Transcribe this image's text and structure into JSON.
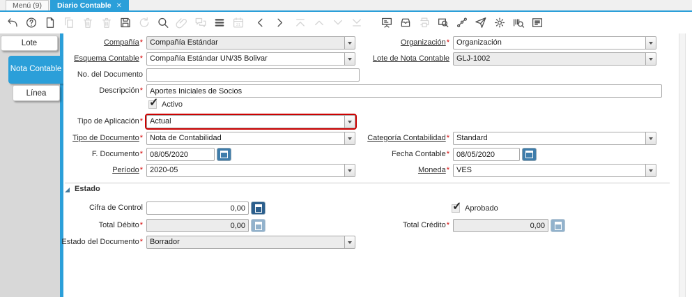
{
  "accent_color": "#2b9fd9",
  "required_marker": "*",
  "glyphs": {
    "checkmark": "✓",
    "close": "✕"
  },
  "tabbar": {
    "tabs": [
      {
        "label": "Menú (9)",
        "active": false
      },
      {
        "label": "Diario Contable",
        "active": true,
        "close_icon": "✕"
      }
    ]
  },
  "toolbar": {
    "buttons": [
      {
        "icon": "undo-icon",
        "enabled": true
      },
      {
        "icon": "help-icon",
        "enabled": true
      },
      {
        "icon": "new-record-icon",
        "enabled": true
      },
      {
        "icon": "copy-record-icon",
        "enabled": false
      },
      {
        "icon": "delete-record-icon",
        "enabled": false
      },
      {
        "icon": "delete-selection-icon",
        "enabled": false
      },
      {
        "icon": "save-icon",
        "enabled": true
      },
      {
        "icon": "refresh-icon",
        "enabled": false
      },
      {
        "icon": "find-icon",
        "enabled": true
      },
      {
        "icon": "attachment-icon",
        "enabled": false
      },
      {
        "icon": "chat-icon",
        "enabled": false
      },
      {
        "icon": "grid-toggle-icon",
        "enabled": true
      },
      {
        "icon": "calendar-icon",
        "enabled": false
      },
      {
        "icon": "previous-record-icon",
        "enabled": true
      },
      {
        "icon": "next-record-icon",
        "enabled": true
      },
      {
        "icon": "first-record-icon",
        "enabled": false
      },
      {
        "icon": "parent-record-icon",
        "enabled": false
      },
      {
        "icon": "detail-record-icon",
        "enabled": false
      },
      {
        "icon": "last-record-icon",
        "enabled": false
      },
      {
        "icon": "report-icon",
        "enabled": true
      },
      {
        "icon": "archive-icon",
        "enabled": true
      },
      {
        "icon": "print-icon",
        "enabled": false
      },
      {
        "icon": "zoom-window-icon",
        "enabled": true
      },
      {
        "icon": "workflow-icon",
        "enabled": true
      },
      {
        "icon": "send-request-icon",
        "enabled": true
      },
      {
        "icon": "settings-icon",
        "enabled": true
      },
      {
        "icon": "barcode-scan-icon",
        "enabled": true
      },
      {
        "icon": "document-report-icon",
        "enabled": true
      }
    ]
  },
  "sidebar": {
    "tabs": [
      {
        "label": "Lote",
        "active": false
      },
      {
        "label": "Nota Contable",
        "active": true
      },
      {
        "label": "Línea",
        "active": false
      }
    ]
  },
  "form": {
    "compania": {
      "label": "Compañía",
      "value": "Compañía Estándar",
      "required": true,
      "readonly": true
    },
    "organizacion": {
      "label": "Organización",
      "value": "Organización",
      "required": true
    },
    "esquema": {
      "label": "Esquema Contable",
      "value": "Compañía Estándar UN/35 Bolivar",
      "required": true
    },
    "lote_nota": {
      "label": "Lote de Nota Contable",
      "value": "GLJ-1002",
      "readonly": true
    },
    "no_documento": {
      "label": "No. del Documento",
      "value": ""
    },
    "descripcion": {
      "label": "Descripción",
      "value": "Aportes Iniciales de Socios",
      "required": true
    },
    "activo": {
      "label": "Activo",
      "checked": true
    },
    "tipo_aplicacion": {
      "label": "Tipo de Aplicación",
      "value": "Actual",
      "required": true,
      "focused": true
    },
    "tipo_documento": {
      "label": "Tipo de Documento",
      "value": "Nota de Contabilidad",
      "required": true
    },
    "categoria": {
      "label": "Categoría Contabilidad",
      "value": "Standard",
      "required": true
    },
    "f_documento": {
      "label": "F. Documento",
      "value": "08/05/2020",
      "required": true
    },
    "fecha_contable": {
      "label": "Fecha Contable",
      "value": "08/05/2020",
      "required": true
    },
    "periodo": {
      "label": "Período",
      "value": "2020-05",
      "required": true
    },
    "moneda": {
      "label": "Moneda",
      "value": "VES",
      "required": true
    },
    "grupo_estado": {
      "label": "Estado"
    },
    "cifra_control": {
      "label": "Cifra de Control",
      "value": "0,00"
    },
    "aprobado": {
      "label": "Aprobado",
      "checked": true
    },
    "total_debito": {
      "label": "Total Débito",
      "value": "0,00",
      "required": true,
      "readonly": true
    },
    "total_credito": {
      "label": "Total Crédito",
      "value": "0,00",
      "required": true,
      "readonly": true
    },
    "estado_documento": {
      "label": "Estado del Documento",
      "value": "Borrador",
      "required": true,
      "readonly": true
    }
  }
}
